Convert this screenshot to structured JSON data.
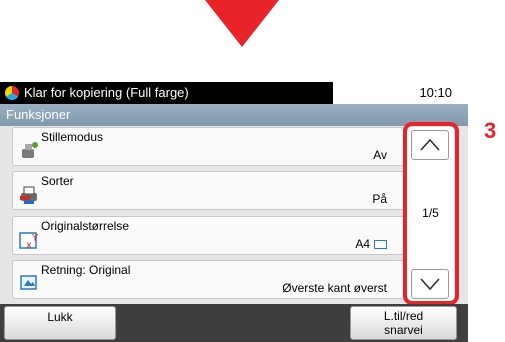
{
  "status": {
    "message": "Klar for kopiering (Full farge)",
    "time": "10:10"
  },
  "header": {
    "title": "Funksjoner"
  },
  "rows": [
    {
      "label": "Stillemodus",
      "value": "Av",
      "icon": "quiet-mode-icon"
    },
    {
      "label": "Sorter",
      "value": "På",
      "icon": "collate-icon"
    },
    {
      "label": "Originalstørrelse",
      "value": "A4",
      "icon": "original-size-icon"
    },
    {
      "label": "Retning: Original",
      "value": "Øverste kant øverst",
      "icon": "orientation-icon"
    }
  ],
  "scroll": {
    "page": "1/5"
  },
  "callout": {
    "label": "3"
  },
  "footer": {
    "close_label": "Lukk",
    "shortcut_line1": "L.til/red",
    "shortcut_line2": "snarvei"
  },
  "colors": {
    "accent": "#e8232a",
    "header": "#8ea4b8",
    "footer": "#3f3f3f"
  }
}
